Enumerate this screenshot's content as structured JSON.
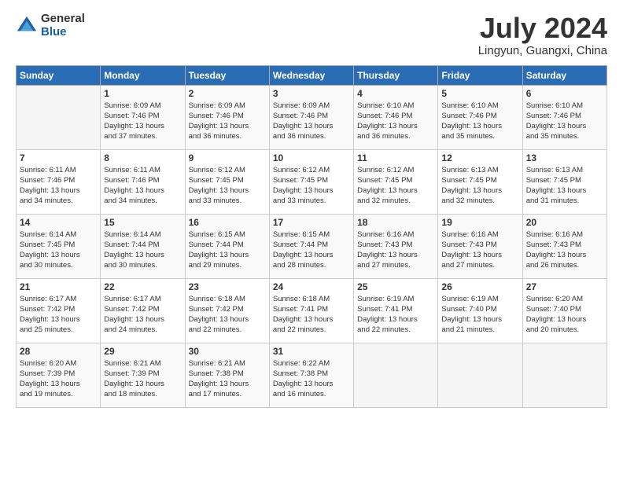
{
  "logo": {
    "general": "General",
    "blue": "Blue"
  },
  "title": "July 2024",
  "subtitle": "Lingyun, Guangxi, China",
  "days_header": [
    "Sunday",
    "Monday",
    "Tuesday",
    "Wednesday",
    "Thursday",
    "Friday",
    "Saturday"
  ],
  "weeks": [
    [
      {
        "num": "",
        "info": ""
      },
      {
        "num": "1",
        "info": "Sunrise: 6:09 AM\nSunset: 7:46 PM\nDaylight: 13 hours\nand 37 minutes."
      },
      {
        "num": "2",
        "info": "Sunrise: 6:09 AM\nSunset: 7:46 PM\nDaylight: 13 hours\nand 36 minutes."
      },
      {
        "num": "3",
        "info": "Sunrise: 6:09 AM\nSunset: 7:46 PM\nDaylight: 13 hours\nand 36 minutes."
      },
      {
        "num": "4",
        "info": "Sunrise: 6:10 AM\nSunset: 7:46 PM\nDaylight: 13 hours\nand 36 minutes."
      },
      {
        "num": "5",
        "info": "Sunrise: 6:10 AM\nSunset: 7:46 PM\nDaylight: 13 hours\nand 35 minutes."
      },
      {
        "num": "6",
        "info": "Sunrise: 6:10 AM\nSunset: 7:46 PM\nDaylight: 13 hours\nand 35 minutes."
      }
    ],
    [
      {
        "num": "7",
        "info": ""
      },
      {
        "num": "8",
        "info": "Sunrise: 6:11 AM\nSunset: 7:46 PM\nDaylight: 13 hours\nand 34 minutes."
      },
      {
        "num": "9",
        "info": "Sunrise: 6:12 AM\nSunset: 7:45 PM\nDaylight: 13 hours\nand 33 minutes."
      },
      {
        "num": "10",
        "info": "Sunrise: 6:12 AM\nSunset: 7:45 PM\nDaylight: 13 hours\nand 33 minutes."
      },
      {
        "num": "11",
        "info": "Sunrise: 6:12 AM\nSunset: 7:45 PM\nDaylight: 13 hours\nand 32 minutes."
      },
      {
        "num": "12",
        "info": "Sunrise: 6:13 AM\nSunset: 7:45 PM\nDaylight: 13 hours\nand 32 minutes."
      },
      {
        "num": "13",
        "info": "Sunrise: 6:13 AM\nSunset: 7:45 PM\nDaylight: 13 hours\nand 31 minutes."
      }
    ],
    [
      {
        "num": "14",
        "info": ""
      },
      {
        "num": "15",
        "info": "Sunrise: 6:14 AM\nSunset: 7:44 PM\nDaylight: 13 hours\nand 30 minutes."
      },
      {
        "num": "16",
        "info": "Sunrise: 6:15 AM\nSunset: 7:44 PM\nDaylight: 13 hours\nand 29 minutes."
      },
      {
        "num": "17",
        "info": "Sunrise: 6:15 AM\nSunset: 7:44 PM\nDaylight: 13 hours\nand 28 minutes."
      },
      {
        "num": "18",
        "info": "Sunrise: 6:16 AM\nSunset: 7:43 PM\nDaylight: 13 hours\nand 27 minutes."
      },
      {
        "num": "19",
        "info": "Sunrise: 6:16 AM\nSunset: 7:43 PM\nDaylight: 13 hours\nand 27 minutes."
      },
      {
        "num": "20",
        "info": "Sunrise: 6:16 AM\nSunset: 7:43 PM\nDaylight: 13 hours\nand 26 minutes."
      }
    ],
    [
      {
        "num": "21",
        "info": ""
      },
      {
        "num": "22",
        "info": "Sunrise: 6:17 AM\nSunset: 7:42 PM\nDaylight: 13 hours\nand 24 minutes."
      },
      {
        "num": "23",
        "info": "Sunrise: 6:18 AM\nSunset: 7:42 PM\nDaylight: 13 hours\nand 22 minutes."
      },
      {
        "num": "24",
        "info": "Sunrise: 6:18 AM\nSunset: 7:41 PM\nDaylight: 13 hours\nand 22 minutes."
      },
      {
        "num": "25",
        "info": "Sunrise: 6:19 AM\nSunset: 7:41 PM\nDaylight: 13 hours\nand 22 minutes."
      },
      {
        "num": "26",
        "info": "Sunrise: 6:19 AM\nSunset: 7:40 PM\nDaylight: 13 hours\nand 21 minutes."
      },
      {
        "num": "27",
        "info": "Sunrise: 6:20 AM\nSunset: 7:40 PM\nDaylight: 13 hours\nand 20 minutes."
      }
    ],
    [
      {
        "num": "28",
        "info": "Sunrise: 6:20 AM\nSunset: 7:39 PM\nDaylight: 13 hours\nand 19 minutes."
      },
      {
        "num": "29",
        "info": "Sunrise: 6:21 AM\nSunset: 7:39 PM\nDaylight: 13 hours\nand 18 minutes."
      },
      {
        "num": "30",
        "info": "Sunrise: 6:21 AM\nSunset: 7:38 PM\nDaylight: 13 hours\nand 17 minutes."
      },
      {
        "num": "31",
        "info": "Sunrise: 6:22 AM\nSunset: 7:38 PM\nDaylight: 13 hours\nand 16 minutes."
      },
      {
        "num": "",
        "info": ""
      },
      {
        "num": "",
        "info": ""
      },
      {
        "num": "",
        "info": ""
      }
    ]
  ],
  "week_sunday_info": [
    "Sunrise: 6:11 AM\nSunset: 7:46 PM\nDaylight: 13 hours\nand 34 minutes.",
    "Sunrise: 6:14 AM\nSunset: 7:45 PM\nDaylight: 13 hours\nand 30 minutes.",
    "Sunrise: 6:17 AM\nSunset: 7:42 PM\nDaylight: 13 hours\nand 25 minutes."
  ]
}
